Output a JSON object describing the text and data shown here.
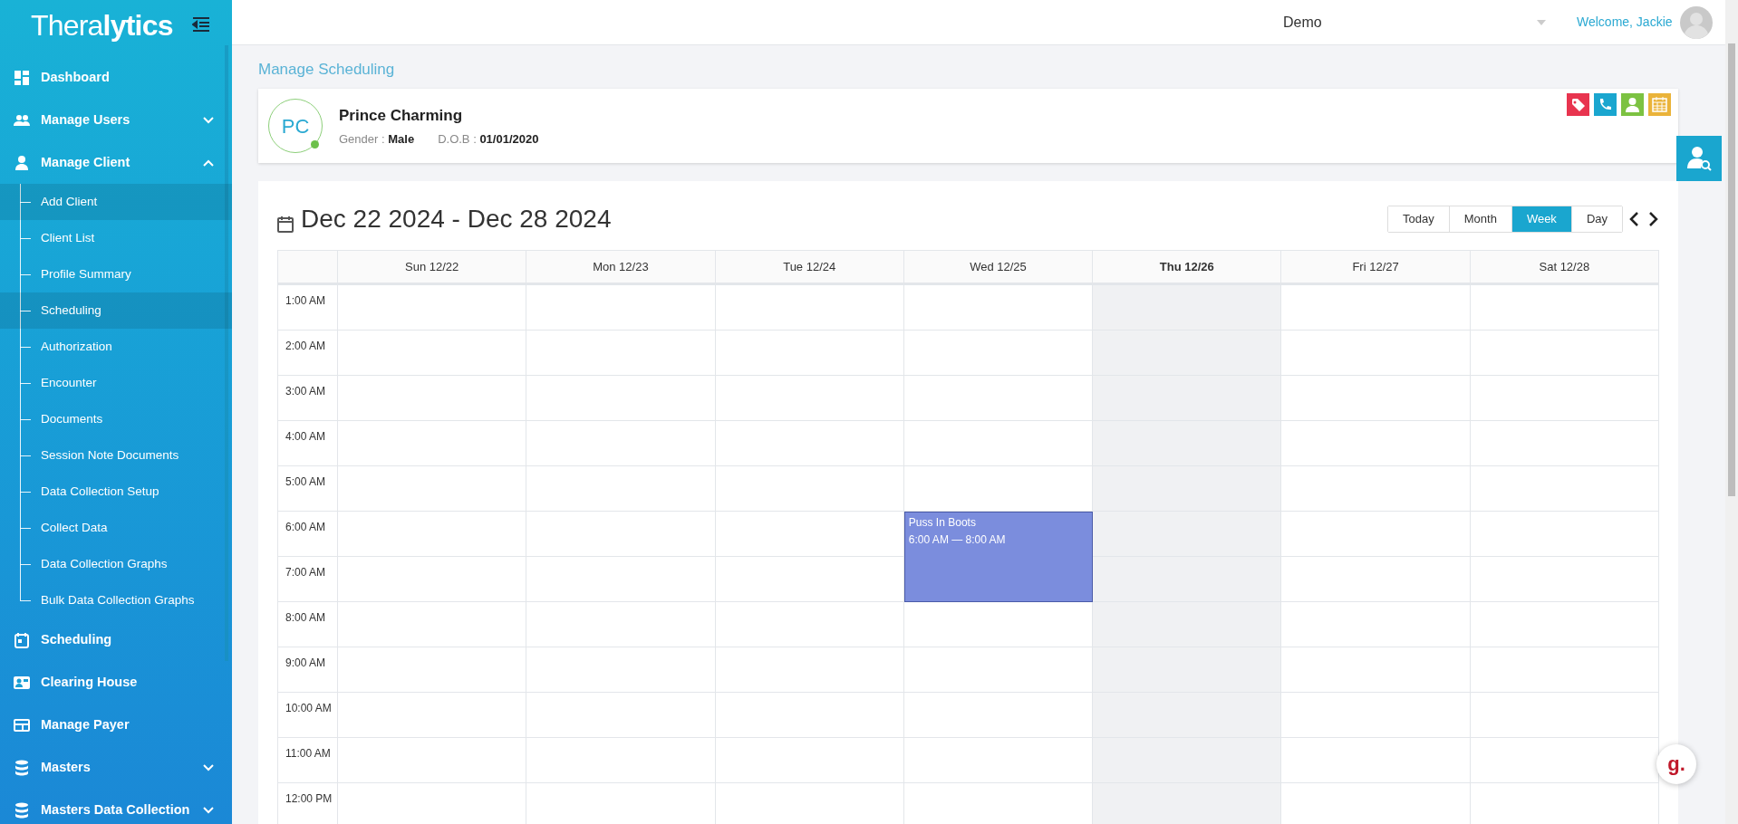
{
  "sidebar": {
    "logo_light": "Thera",
    "logo_bold": "lytics",
    "items": [
      {
        "kind": "main",
        "label": "Dashboard",
        "selected": false
      },
      {
        "kind": "main",
        "label": "Manage Users",
        "expanded": false,
        "selected": false
      },
      {
        "kind": "main",
        "label": "Manage Client",
        "expanded": true,
        "selected": false,
        "children": [
          {
            "label": "Add Client",
            "selected": true
          },
          {
            "label": "Client List",
            "selected": false
          },
          {
            "label": "Profile Summary",
            "selected": false
          },
          {
            "label": "Scheduling",
            "selected": true
          },
          {
            "label": "Authorization",
            "selected": false
          },
          {
            "label": "Encounter",
            "selected": false
          },
          {
            "label": "Documents",
            "selected": false
          },
          {
            "label": "Session Note Documents",
            "selected": false
          },
          {
            "label": "Data Collection Setup",
            "selected": false
          },
          {
            "label": "Collect Data",
            "selected": false
          },
          {
            "label": "Data Collection Graphs",
            "selected": false
          },
          {
            "label": "Bulk Data Collection Graphs",
            "selected": false
          }
        ]
      },
      {
        "kind": "main",
        "label": "Scheduling",
        "selected": false
      },
      {
        "kind": "main",
        "label": "Clearing House",
        "selected": false
      },
      {
        "kind": "main",
        "label": "Manage Payer",
        "selected": false
      },
      {
        "kind": "main",
        "label": "Masters",
        "expanded": false,
        "selected": false
      },
      {
        "kind": "main",
        "label": "Masters Data Collection",
        "expanded": false,
        "selected": false
      }
    ]
  },
  "topbar": {
    "organization": "Demo",
    "welcome": "Welcome, Jackie"
  },
  "page_title": "Manage Scheduling",
  "client": {
    "initials": "PC",
    "name": "Prince Charming",
    "gender_label": "Gender :",
    "gender": "Male",
    "dob_label": "D.O.B :",
    "dob": "01/01/2020",
    "online": true
  },
  "calendar": {
    "range": "Dec 22 2024 - Dec 28 2024",
    "views": [
      {
        "label": "Today",
        "selected": false
      },
      {
        "label": "Month",
        "selected": false
      },
      {
        "label": "Week",
        "selected": true
      },
      {
        "label": "Day",
        "selected": false
      }
    ],
    "days": [
      {
        "label": "Sun 12/22",
        "today": false
      },
      {
        "label": "Mon 12/23",
        "today": false
      },
      {
        "label": "Tue 12/24",
        "today": false
      },
      {
        "label": "Wed 12/25",
        "today": false,
        "events": [
          {
            "title": "Puss In Boots",
            "time": "6:00 AM — 8:00 AM",
            "color": "#7b8ddd"
          }
        ]
      },
      {
        "label": "Thu 12/26",
        "today": true
      },
      {
        "label": "Fri 12/27",
        "today": false
      },
      {
        "label": "Sat 12/28",
        "today": false
      }
    ],
    "hours": [
      "1:00 AM",
      "2:00 AM",
      "3:00 AM",
      "4:00 AM",
      "5:00 AM",
      "6:00 AM",
      "7:00 AM",
      "8:00 AM",
      "9:00 AM",
      "10:00 AM",
      "11:00 AM",
      "12:00 PM"
    ]
  },
  "chat_button": {
    "label": "g."
  }
}
